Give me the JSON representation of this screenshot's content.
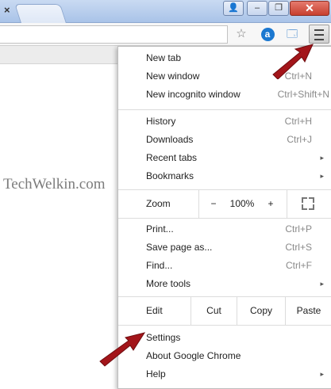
{
  "titlebar": {
    "tab_close": "×",
    "window_buttons": {
      "user": "👤",
      "minimize": "–",
      "maximize": "❐",
      "close": "✕"
    }
  },
  "toolbar": {
    "star_icon": "☆",
    "ext_a_label": "a",
    "ext_b_icon": "🗔",
    "menu_icon": "hamburger-menu-icon"
  },
  "watermark": "TechWelkin.com",
  "menu": {
    "group1": [
      {
        "label": "New tab",
        "shortcut": ""
      },
      {
        "label": "New window",
        "shortcut": "Ctrl+N"
      },
      {
        "label": "New incognito window",
        "shortcut": "Ctrl+Shift+N"
      }
    ],
    "group2": [
      {
        "label": "History",
        "shortcut": "Ctrl+H"
      },
      {
        "label": "Downloads",
        "shortcut": "Ctrl+J"
      },
      {
        "label": "Recent tabs",
        "shortcut": "▸"
      },
      {
        "label": "Bookmarks",
        "shortcut": "▸"
      }
    ],
    "zoom": {
      "label": "Zoom",
      "minus": "−",
      "value": "100%",
      "plus": "+"
    },
    "group3": [
      {
        "label": "Print...",
        "shortcut": "Ctrl+P"
      },
      {
        "label": "Save page as...",
        "shortcut": "Ctrl+S"
      },
      {
        "label": "Find...",
        "shortcut": "Ctrl+F"
      },
      {
        "label": "More tools",
        "shortcut": "▸"
      }
    ],
    "edit": {
      "label": "Edit",
      "cut": "Cut",
      "copy": "Copy",
      "paste": "Paste"
    },
    "group4": [
      {
        "label": "Settings",
        "shortcut": ""
      },
      {
        "label": "About Google Chrome",
        "shortcut": ""
      },
      {
        "label": "Help",
        "shortcut": "▸"
      }
    ]
  },
  "colors": {
    "arrow": "#a3151a",
    "titlebar": "#b7cdee",
    "close": "#c7402f"
  }
}
